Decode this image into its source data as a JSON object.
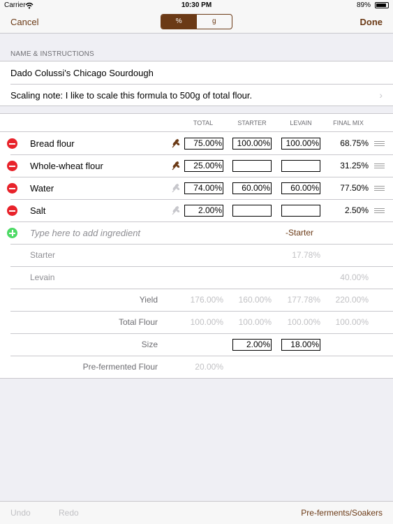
{
  "status": {
    "carrier": "Carrier",
    "wifi_icon": "wifi-icon",
    "time": "10:30 PM",
    "battery": "89%"
  },
  "nav": {
    "cancel": "Cancel",
    "done": "Done",
    "segments": [
      "%",
      "g"
    ],
    "selected_segment": 0
  },
  "section": {
    "header": "NAME & INSTRUCTIONS",
    "name": "Dado Colussi's Chicago Sourdough",
    "note": "Scaling note: I like to scale this formula to 500g of total flour."
  },
  "columns": {
    "total": "TOTAL",
    "starter": "STARTER",
    "levain": "LEVAIN",
    "final": "FINAL MIX"
  },
  "ingredients": [
    {
      "name": "Bread flour",
      "flour": true,
      "total": "75.00%",
      "starter": "100.00%",
      "levain": "100.00%",
      "final": "68.75%"
    },
    {
      "name": "Whole-wheat flour",
      "flour": true,
      "total": "25.00%",
      "starter": "",
      "levain": "",
      "final": "31.25%"
    },
    {
      "name": "Water",
      "flour": false,
      "total": "74.00%",
      "starter": "60.00%",
      "levain": "60.00%",
      "final": "77.50%"
    },
    {
      "name": "Salt",
      "flour": false,
      "total": "2.00%",
      "starter": "",
      "levain": "",
      "final": "2.50%"
    }
  ],
  "add_row": {
    "placeholder": "Type here to add ingredient",
    "starter_label": "-Starter"
  },
  "preferments": [
    {
      "name": "Starter",
      "levain": "17.78%"
    },
    {
      "name": "Levain",
      "final": "40.00%"
    }
  ],
  "summary": {
    "yield": {
      "label": "Yield",
      "total": "176.00%",
      "starter": "160.00%",
      "levain": "177.78%",
      "final": "220.00%"
    },
    "total_flour": {
      "label": "Total Flour",
      "total": "100.00%",
      "starter": "100.00%",
      "levain": "100.00%",
      "final": "100.00%"
    },
    "size": {
      "label": "Size",
      "starter": "2.00%",
      "levain": "18.00%"
    },
    "prefermented": {
      "label": "Pre-fermented Flour",
      "total": "20.00%"
    }
  },
  "toolbar": {
    "undo": "Undo",
    "redo": "Redo",
    "preferments": "Pre-ferments/Soakers"
  },
  "colors": {
    "accent": "#6b3a16",
    "delete": "#e8222a",
    "add": "#4cd964"
  }
}
